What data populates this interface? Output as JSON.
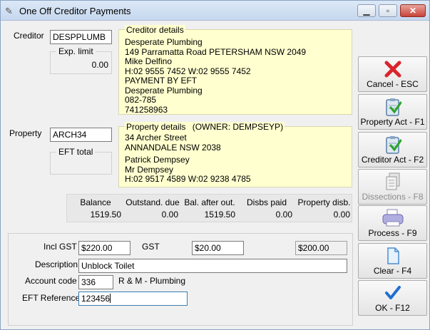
{
  "window": {
    "title": "One Off Creditor Payments"
  },
  "creditor": {
    "label": "Creditor",
    "code": "DESPPLUMB",
    "exp_limit_label": "Exp. limit",
    "exp_limit_value": "0.00"
  },
  "creditor_details": {
    "label": "Creditor details",
    "lines": [
      "Desperate Plumbing",
      "149 Parramatta Road PETERSHAM NSW 2049",
      "Mike Delfino",
      "H:02 9555 7452 W:02 9555 7452",
      "PAYMENT BY EFT",
      "Desperate Plumbing",
      "082-785",
      "741258963"
    ]
  },
  "property": {
    "label": "Property",
    "code": "ARCH34",
    "eft_total_label": "EFT total"
  },
  "property_details": {
    "label": "Property details",
    "owner": "(OWNER:  DEMPSEYP)",
    "lines": [
      "34 Archer Street",
      "ANNANDALE  NSW  2038"
    ],
    "contact_lines": [
      "Patrick Dempsey",
      "Mr Dempsey",
      "H:02 9517 4589 W:02 9238 4785"
    ]
  },
  "summary": [
    {
      "label": "Balance",
      "value": "1519.50"
    },
    {
      "label": "Outstand. due",
      "value": "0.00"
    },
    {
      "label": "Bal. after out.",
      "value": "1519.50"
    },
    {
      "label": "Disbs paid",
      "value": "0.00"
    },
    {
      "label": "Property disb.",
      "value": "0.00"
    }
  ],
  "form": {
    "incl_gst_label": "Incl GST",
    "incl_gst_value": "$220.00",
    "gst_label": "GST",
    "gst_value": "$20.00",
    "ex_gst_value": "$200.00",
    "description_label": "Description",
    "description_value": "Unblock Toilet",
    "account_code_label": "Account code",
    "account_code_value": "336",
    "account_name": "R & M - Plumbing",
    "eft_reference_label": "EFT Reference",
    "eft_reference_value": "123456"
  },
  "buttons": {
    "cancel": "Cancel - ESC",
    "property_act": "Property Act - F1",
    "creditor_act": "Creditor Act - F2",
    "dissections": "Dissections - F8",
    "process": "Process - F9",
    "clear": "Clear - F4",
    "ok": "OK - F12"
  },
  "colors": {
    "detail_bg": "#ffffcf",
    "cancel_icon": "#d9262b",
    "ok_icon": "#1f6fd0",
    "check": "#2aa52a"
  }
}
